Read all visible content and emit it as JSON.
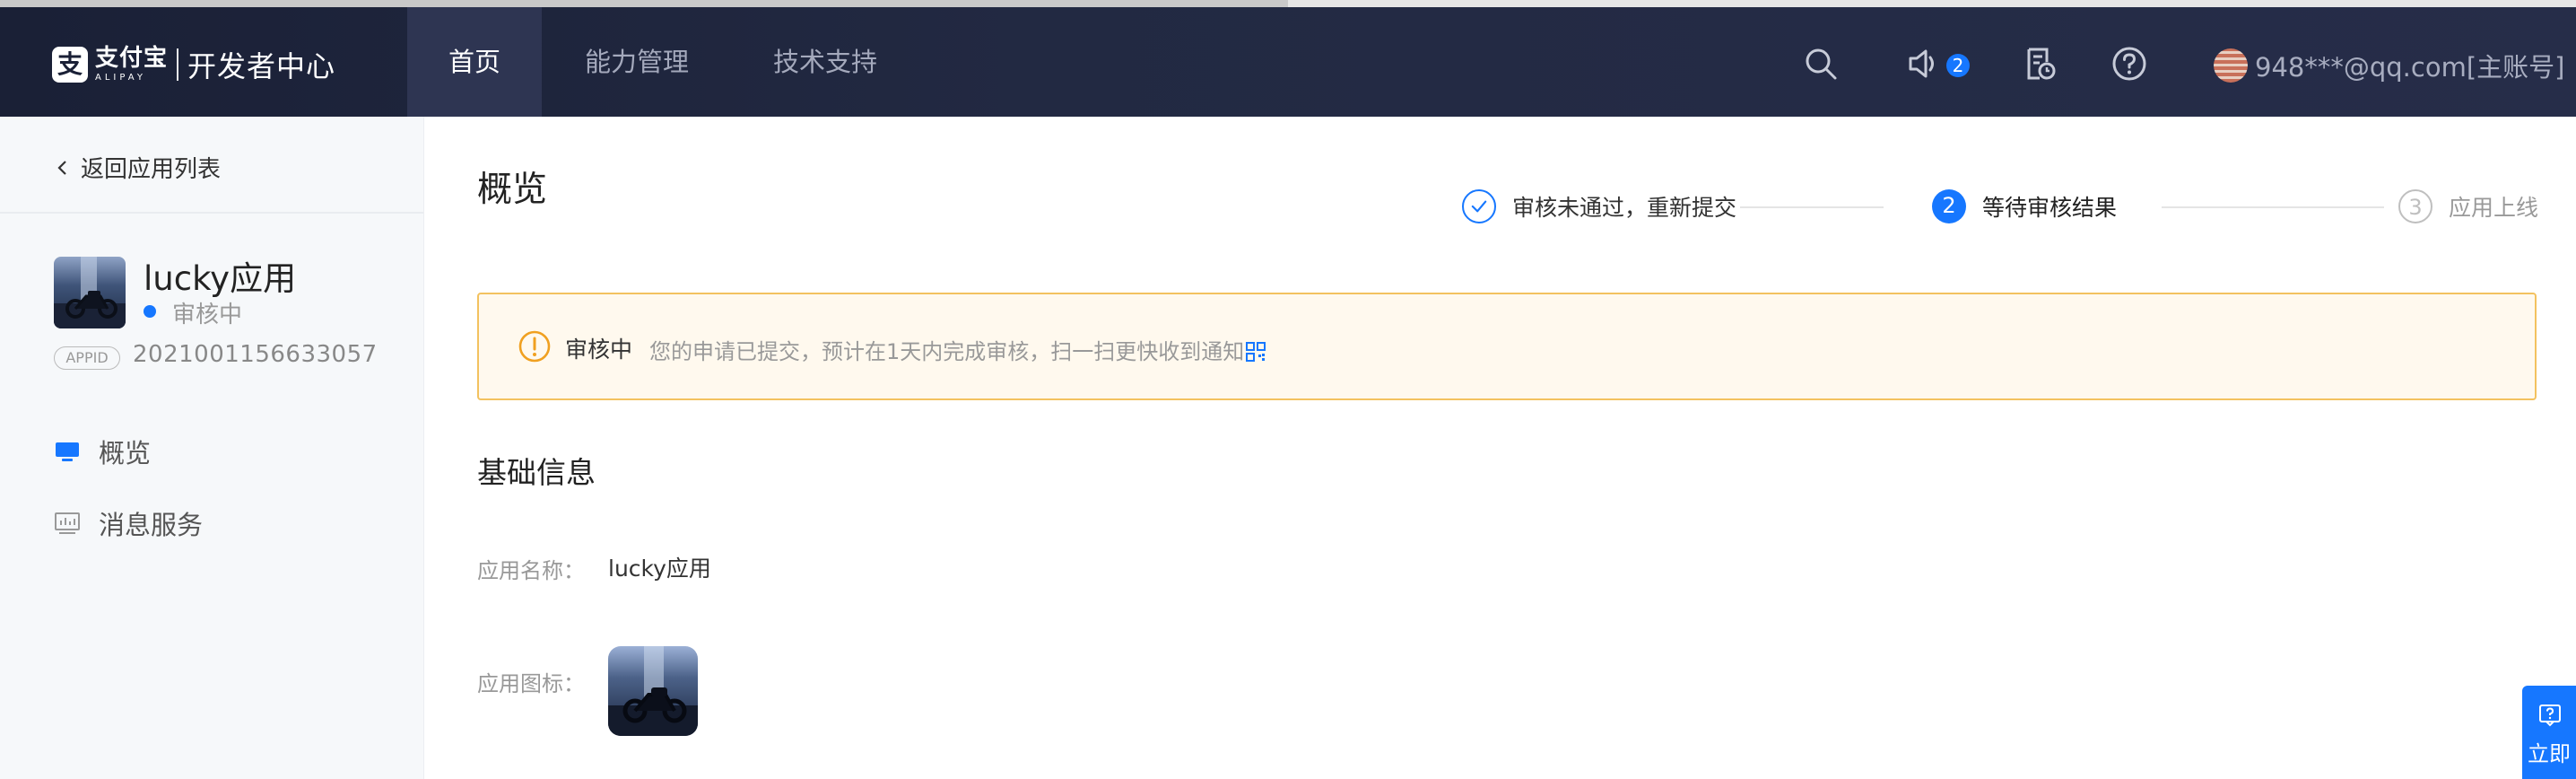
{
  "header": {
    "logo": {
      "brand_cn": "支付宝",
      "brand_en": "ALIPAY",
      "site_title": "开发者中心"
    },
    "nav": [
      {
        "label": "首页",
        "active": true
      },
      {
        "label": "能力管理",
        "active": false
      },
      {
        "label": "技术支持",
        "active": false
      }
    ],
    "notifications_count": "2",
    "account_label": "948***@qq.com[主账号]",
    "icons": [
      "search-icon",
      "speaker-icon",
      "document-clock-icon",
      "help-circle-icon"
    ]
  },
  "sidebar": {
    "back_label": "返回应用列表",
    "app": {
      "name": "lucky应用",
      "status": "审核中",
      "appid_tag": "APPID",
      "appid": "2021001156633057"
    },
    "menu": [
      {
        "label": "概览",
        "icon": "monitor-icon",
        "active": true
      },
      {
        "label": "消息服务",
        "icon": "chart-icon",
        "active": false
      }
    ]
  },
  "main": {
    "title": "概览",
    "steps": [
      {
        "index": "",
        "label": "审核未通过，重新提交",
        "state": "done"
      },
      {
        "index": "2",
        "label": "等待审核结果",
        "state": "current"
      },
      {
        "index": "3",
        "label": "应用上线",
        "state": "pending"
      }
    ],
    "alert": {
      "title": "审核中",
      "message": "您的申请已提交，预计在1天内完成审核，扫一扫更快收到通知"
    },
    "section_title": "基础信息",
    "fields": [
      {
        "label": "应用名称：",
        "value": "lucky应用"
      },
      {
        "label": "应用图标：",
        "value": ""
      }
    ]
  },
  "help_widget": {
    "label": "立即"
  },
  "colors": {
    "nav_bg": "#1a2036",
    "nav_active_bg": "#2e3552",
    "primary": "#1677ff",
    "alert_bg": "#fff9ee",
    "alert_border": "#f3c25f",
    "sidebar_bg": "#f6f8fa"
  }
}
